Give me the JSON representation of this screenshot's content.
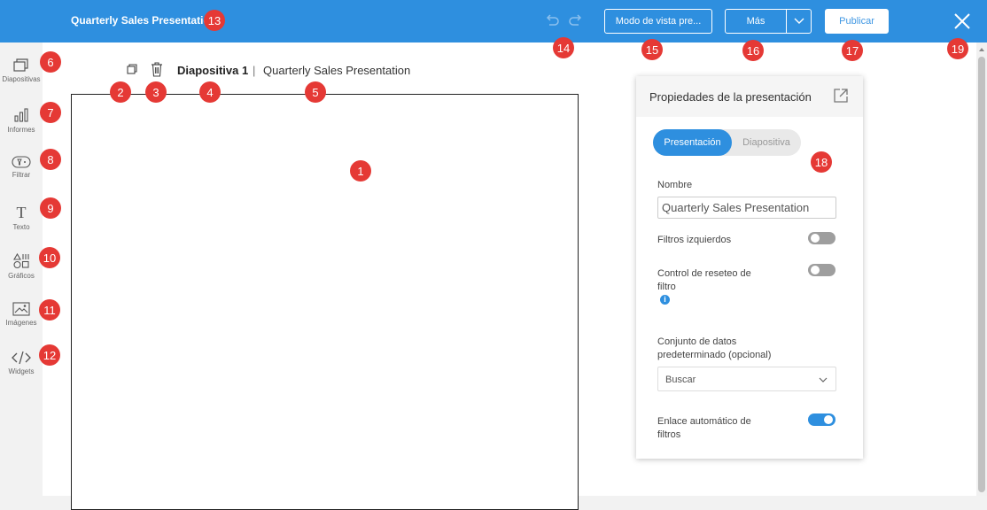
{
  "topbar": {
    "title": "Quarterly Sales Presentation",
    "preview_label": "Modo de vista pre...",
    "more_label": "Más",
    "publish_label": "Publicar"
  },
  "sidebar": {
    "items": [
      {
        "label": "Diapositivas",
        "icon": "slides-icon"
      },
      {
        "label": "Informes",
        "icon": "reports-icon"
      },
      {
        "label": "Filtrar",
        "icon": "filter-icon"
      },
      {
        "label": "Texto",
        "icon": "text-icon"
      },
      {
        "label": "Gráficos",
        "icon": "shapes-icon"
      },
      {
        "label": "Imágenes",
        "icon": "image-icon"
      },
      {
        "label": "Widgets",
        "icon": "code-icon"
      }
    ]
  },
  "slide": {
    "name": "Diapositiva 1",
    "separator": "|",
    "presentation_name": "Quarterly Sales Presentation"
  },
  "properties": {
    "title": "Propiedades de la presentación",
    "tabs": [
      "Presentación",
      "Diapositiva"
    ],
    "name_label": "Nombre",
    "name_value": "Quarterly Sales Presentation",
    "left_filters_label": "Filtros izquierdos",
    "left_filters_on": false,
    "reset_filter_label": "Control de reseteo de filtro",
    "reset_filter_on": false,
    "dataset_label": "Conjunto de datos predeterminado (opcional)",
    "dataset_placeholder": "Buscar",
    "auto_link_label": "Enlace automático de filtros",
    "auto_link_on": true
  },
  "markers": [
    "1",
    "2",
    "3",
    "4",
    "5",
    "6",
    "7",
    "8",
    "9",
    "10",
    "11",
    "12",
    "13",
    "14",
    "15",
    "16",
    "17",
    "18",
    "19"
  ],
  "colors": {
    "topbar": "#2e8fdf",
    "accent": "#2e8fdf",
    "marker": "#e53935"
  }
}
